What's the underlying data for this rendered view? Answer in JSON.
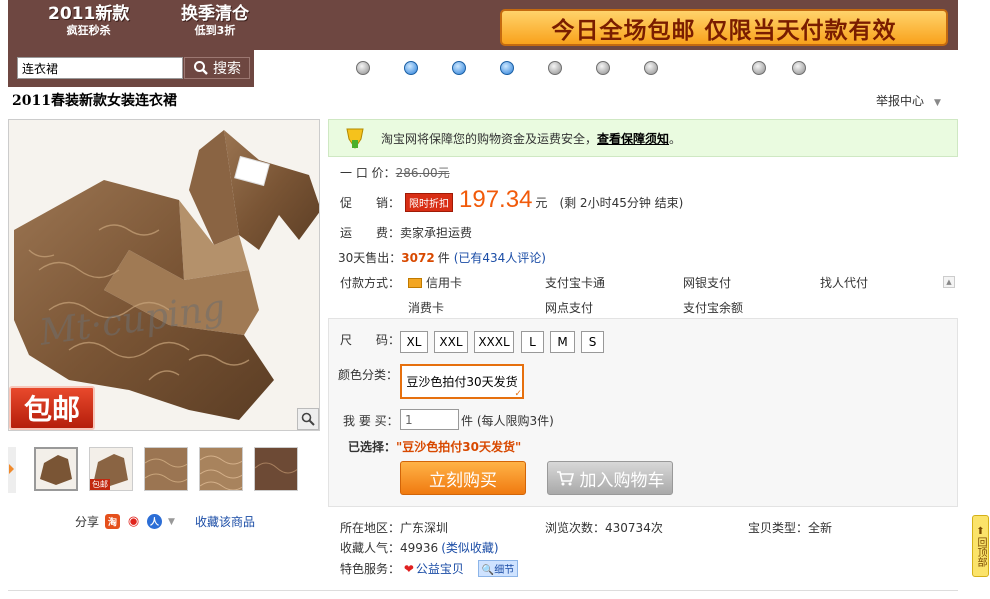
{
  "banner": {
    "promo1_big": "2011新款",
    "promo1_small": "疯狂秒杀",
    "promo2_big": "换季清仓",
    "promo2_small": "低到3折",
    "headline": "今日全场包邮 仅限当天付款有效"
  },
  "search": {
    "value": "连衣裙",
    "button_label": "搜索"
  },
  "product": {
    "title": "2011春装新款女装连衣裙",
    "report_label": "举报中心",
    "main_badge": "包邮",
    "watermark": "Mt·cuping"
  },
  "share": {
    "label": "分享",
    "collect_link": "收藏该商品"
  },
  "guarantee": {
    "text": "淘宝网将保障您的购物资金及运费安全，",
    "link": "查看保障须知",
    "end": "。"
  },
  "price": {
    "original_label": "一 口 价：",
    "original_value": "286.00元",
    "promo_label": "促　　销：",
    "promo_badge": "限时折扣",
    "promo_value": "197.34",
    "promo_unit": "元",
    "remaining": "(剩 2小时45分钟 结束)"
  },
  "shipping": {
    "label": "运　　费：",
    "value": "卖家承担运费"
  },
  "sales": {
    "label": "30天售出：",
    "count": "3072",
    "unit": "件",
    "reviews": "(已有434人评论)"
  },
  "payment": {
    "label": "付款方式：",
    "options": [
      "信用卡",
      "支付宝卡通",
      "网银支付",
      "找人代付",
      "消费卡",
      "网点支付",
      "支付宝余额"
    ]
  },
  "purchase": {
    "size_label": "尺　　码：",
    "sizes": [
      "XL",
      "XXL",
      "XXXL",
      "L",
      "M",
      "S"
    ],
    "color_label": "颜色分类：",
    "color_value": "豆沙色拍付30天发货",
    "qty_label": "我 要 买：",
    "qty_value": "1",
    "qty_note": "件 (每人限购3件)",
    "selected_label": "已选择：",
    "selected_value": "\"豆沙色拍付30天发货\"",
    "buy_now": "立刻购买",
    "add_cart": "加入购物车"
  },
  "meta": {
    "location_label": "所在地区：",
    "location": "广东深圳",
    "views_label": "浏览次数：",
    "views": "430734次",
    "type_label": "宝贝类型：",
    "type": "全新",
    "popularity_label": "收藏人气：",
    "popularity": "49936",
    "similar_link": "(类似收藏)",
    "service_label": "特色服务：",
    "service": "公益宝贝",
    "detail_badge": "细节"
  },
  "back_top": "回顶部",
  "colors": {
    "banner_bg": "#6e4741",
    "price_orange": "#f15a0a",
    "link_blue": "#1b4da6",
    "buy_orange": "#f07a10"
  }
}
